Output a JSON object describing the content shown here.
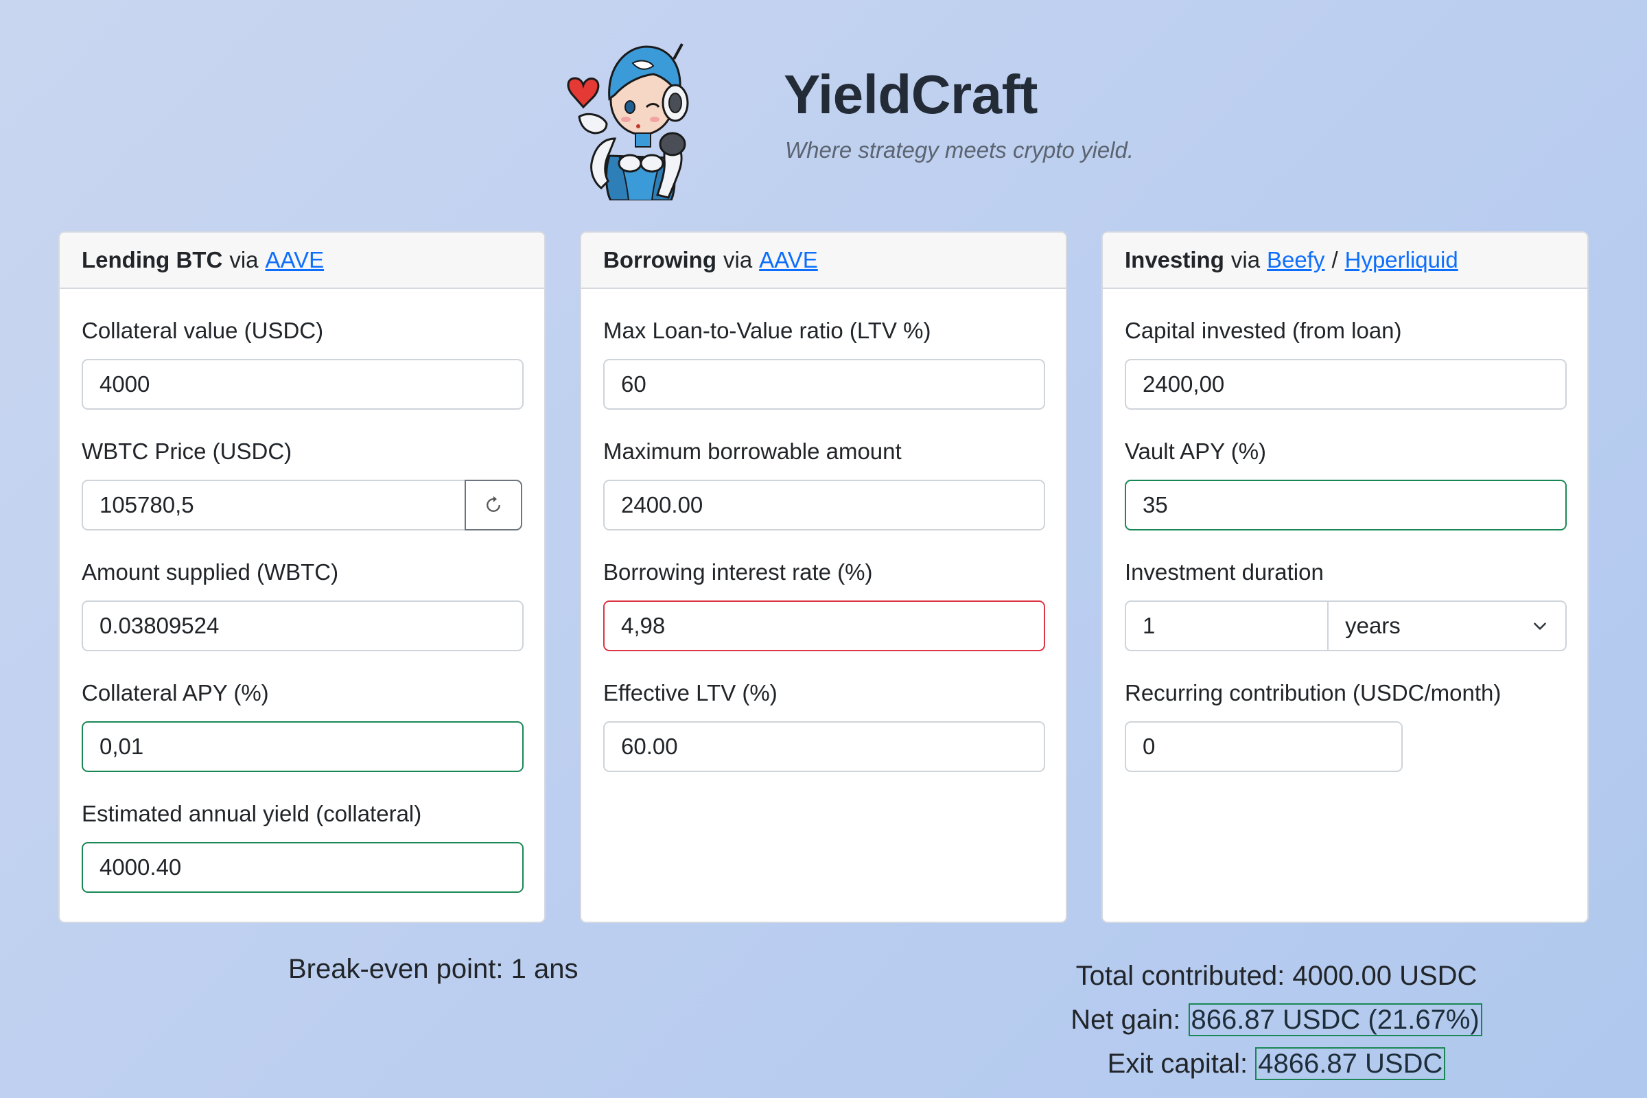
{
  "brand": {
    "title": "YieldCraft",
    "tagline": "Where strategy meets crypto yield."
  },
  "cards": {
    "lending": {
      "title": "Lending BTC",
      "via": "via",
      "links": [
        "AAVE"
      ],
      "fields": {
        "collateral_value": {
          "label": "Collateral value (USDC)",
          "value": "4000"
        },
        "wbtc_price": {
          "label": "WBTC Price (USDC)",
          "value": "105780,5"
        },
        "amount_supplied": {
          "label": "Amount supplied (WBTC)",
          "value": "0.03809524"
        },
        "collateral_apy": {
          "label": "Collateral APY (%)",
          "value": "0,01"
        },
        "annual_yield": {
          "label": "Estimated annual yield (collateral)",
          "value": "4000.40"
        }
      }
    },
    "borrowing": {
      "title": "Borrowing",
      "via": "via",
      "links": [
        "AAVE"
      ],
      "fields": {
        "max_ltv": {
          "label": "Max Loan-to-Value ratio (LTV %)",
          "value": "60"
        },
        "max_borrowable": {
          "label": "Maximum borrowable amount",
          "value": "2400.00"
        },
        "interest_rate": {
          "label": "Borrowing interest rate (%)",
          "value": "4,98"
        },
        "effective_ltv": {
          "label": "Effective LTV (%)",
          "value": "60.00"
        }
      }
    },
    "investing": {
      "title": "Investing",
      "via": "via",
      "links": [
        "Beefy",
        "Hyperliquid"
      ],
      "link_separator": "/",
      "fields": {
        "capital_invested": {
          "label": "Capital invested (from loan)",
          "value": "2400,00"
        },
        "vault_apy": {
          "label": "Vault APY (%)",
          "value": "35"
        },
        "duration": {
          "label": "Investment duration",
          "value": "1",
          "unit": "years"
        },
        "recurring": {
          "label": "Recurring contribution (USDC/month)",
          "value": "0"
        }
      }
    }
  },
  "results": {
    "breakeven": "Break-even point: 1 ans",
    "total_label": "Total contributed:",
    "total_value": "4000.00 USDC",
    "net_gain_label": "Net gain:",
    "net_gain_value": "866.87 USDC (21.67%)",
    "exit_label": "Exit capital:",
    "exit_value": "4866.87 USDC"
  },
  "icons": {
    "refresh": "refresh-icon",
    "chevron": "chevron-down-icon",
    "mascot": "robot-girl-mascot-icon",
    "heart": "heart-icon"
  },
  "colors": {
    "link": "#0d6efd",
    "valid": "#198754",
    "invalid": "#dc3545"
  }
}
